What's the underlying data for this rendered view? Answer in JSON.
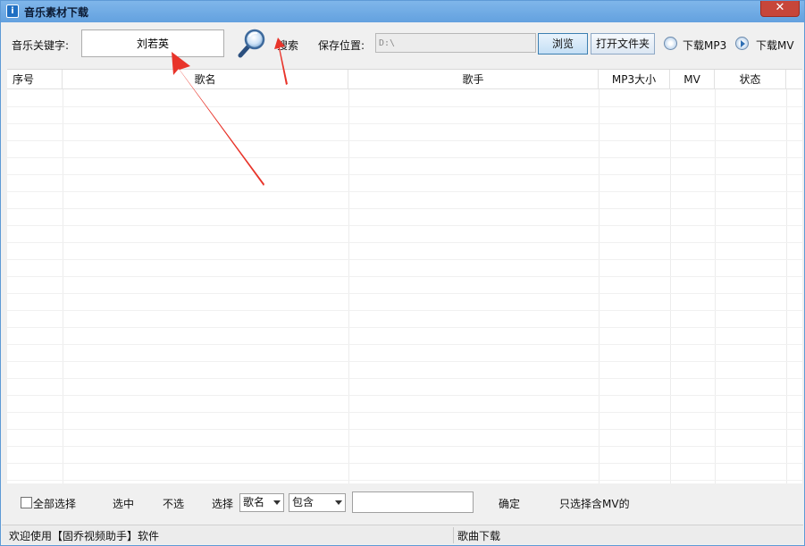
{
  "window": {
    "title": "音乐素材下载",
    "app_icon_glyph": "i",
    "close_glyph": "✕"
  },
  "toolbar": {
    "keyword_label": "音乐关键字:",
    "keyword_value": "刘若英",
    "search_icon": "magnifier-icon",
    "search_label": "搜索",
    "save_label": "保存位置:",
    "save_path": "D:\\",
    "browse_label": "浏览",
    "open_folder_label": "打开文件夹",
    "download_mp3_label": "下载MP3",
    "download_mv_label": "下载MV"
  },
  "table": {
    "columns": [
      "序号",
      "歌名",
      "歌手",
      "MP3大小",
      "MV",
      "状态"
    ],
    "rows": []
  },
  "bottom": {
    "select_all_label": "全部选择",
    "select_label": "选中",
    "unselect_label": "不选",
    "choose_label": "选择",
    "field_option": "歌名",
    "match_option": "包含",
    "confirm_label": "确定",
    "mv_only_label": "只选择含MV的"
  },
  "status": {
    "left_text": "欢迎使用【固乔视频助手】软件",
    "right_text": "歌曲下载"
  },
  "colors": {
    "titlebar": "#63a1df",
    "close": "#c7463a",
    "arrow": "#e8342a"
  }
}
